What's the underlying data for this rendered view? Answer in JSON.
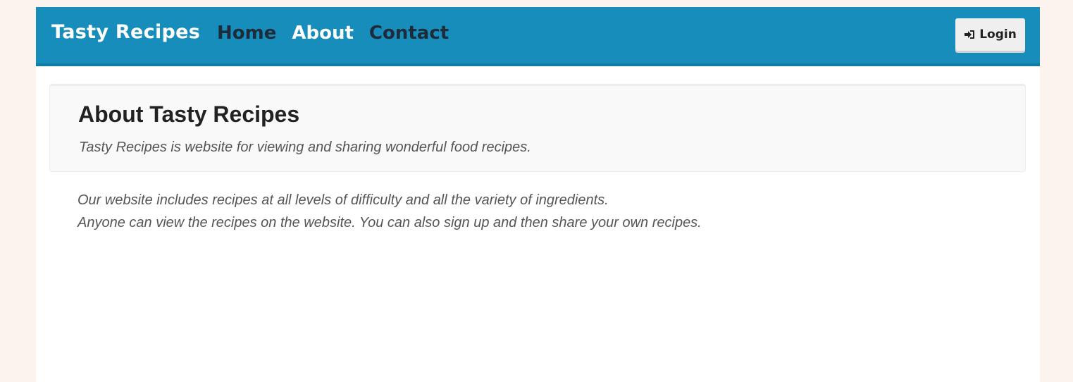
{
  "navbar": {
    "brand": "Tasty Recipes",
    "links": [
      {
        "label": "Home",
        "active": false
      },
      {
        "label": "About",
        "active": true
      },
      {
        "label": "Contact",
        "active": false
      }
    ],
    "login_label": "Login",
    "login_icon": "sign-in-icon"
  },
  "about": {
    "title": "About Tasty Recipes",
    "lead": "Tasty Recipes is website for viewing and sharing wonderful food recipes.",
    "paragraphs": [
      "Our website includes recipes at all levels of difficulty and all the variety of ingredients.",
      "Anyone can view the recipes on the website. You can also sign up and then share your own recipes."
    ]
  },
  "colors": {
    "navbar_bg": "#178dbc",
    "active_link": "#ffffff",
    "inactive_link": "#1d2c3a",
    "page_bg": "#fcf3ee"
  }
}
